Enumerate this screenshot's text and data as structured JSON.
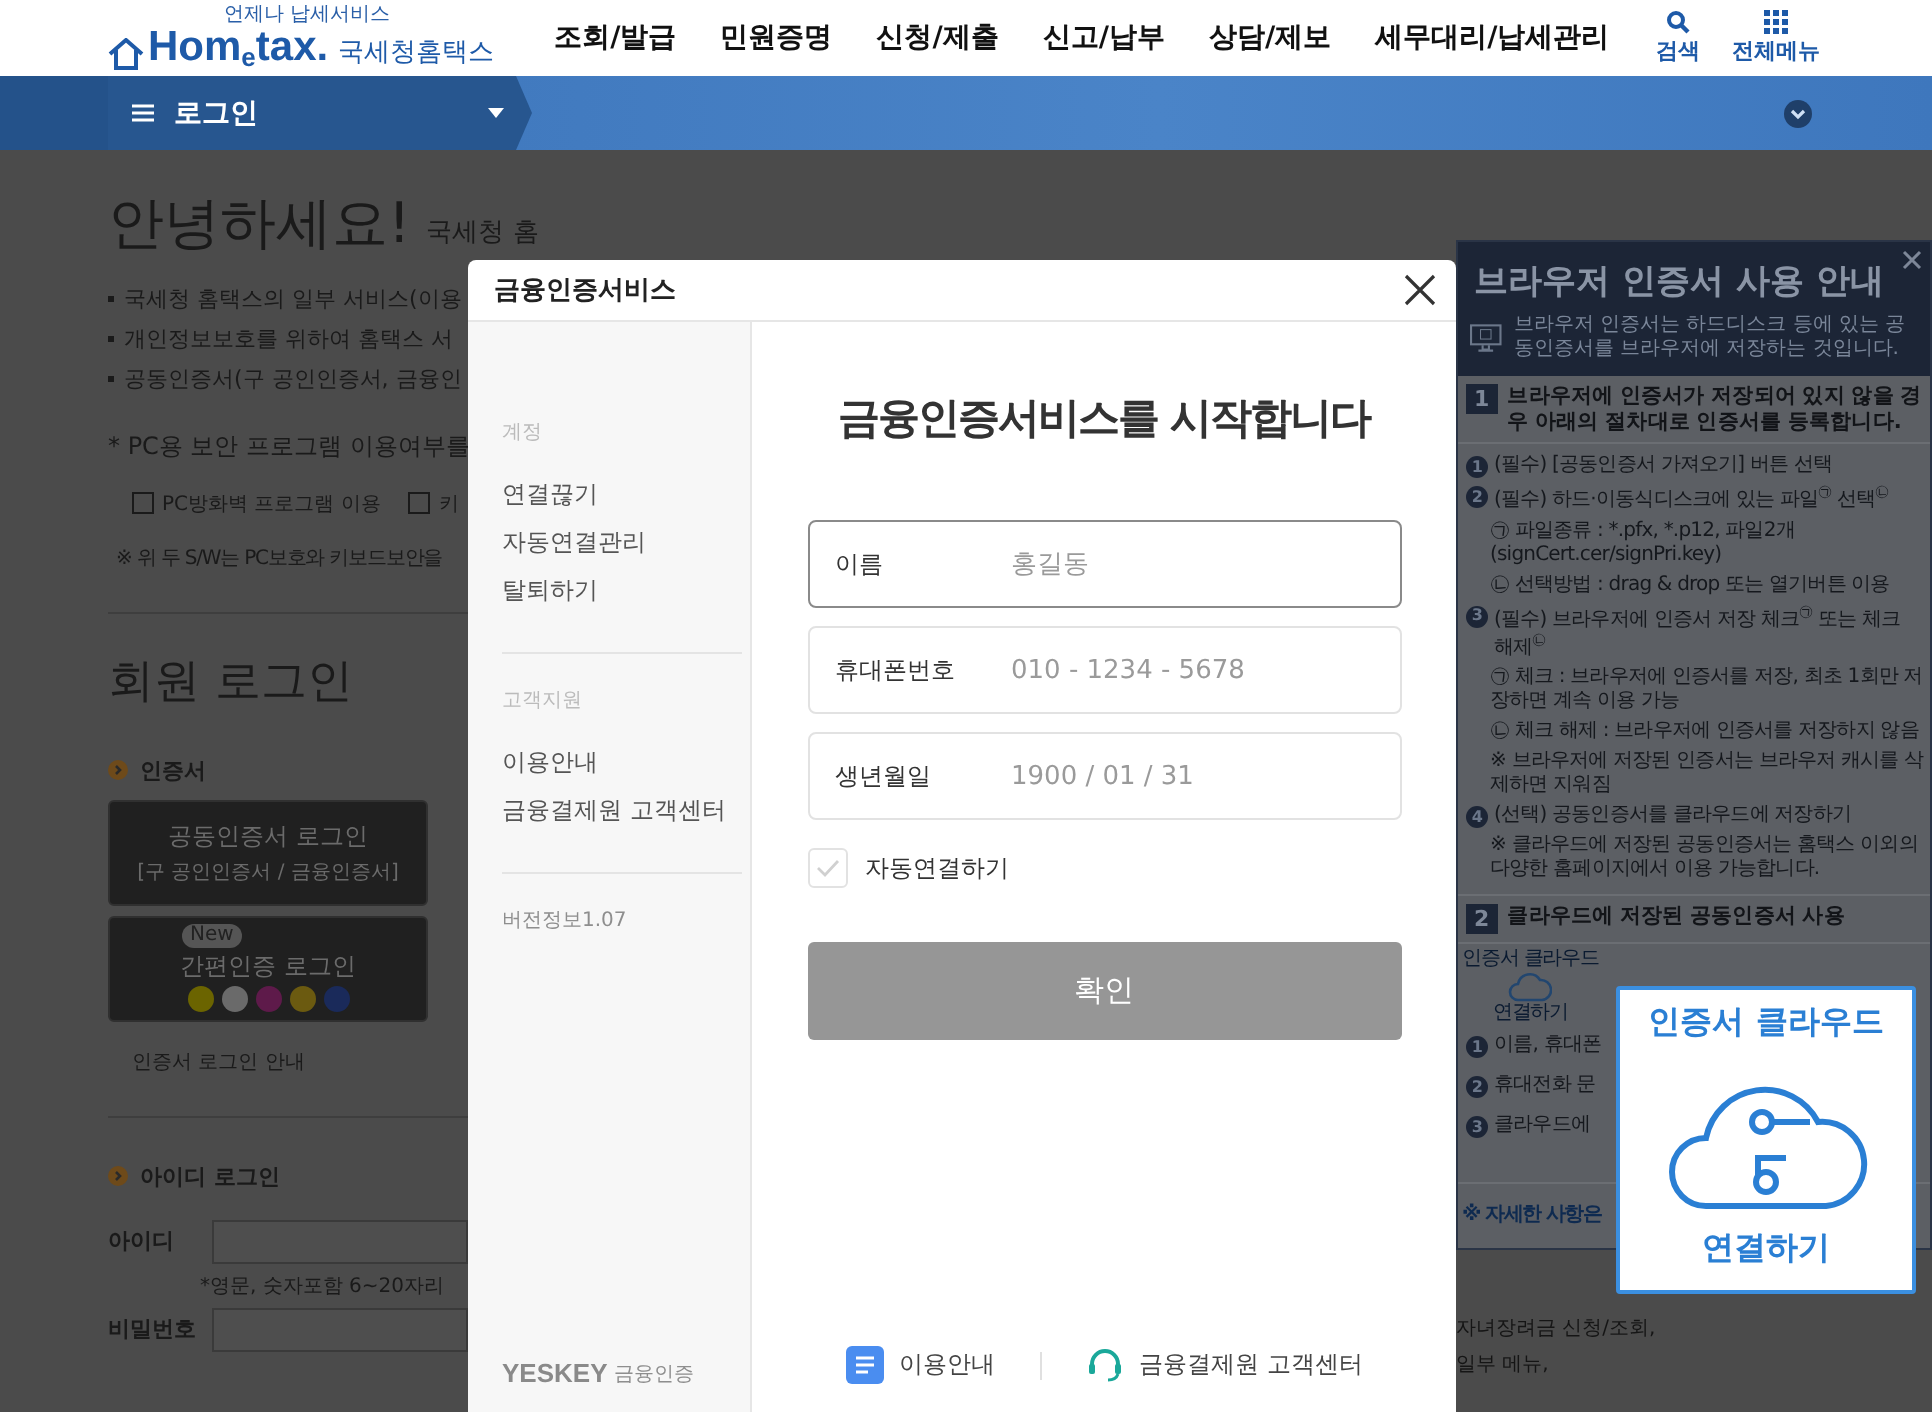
{
  "header": {
    "logo_tagline": "언제나 납세서비스",
    "logo_text": "Hom$_{e}$tax.",
    "logo_name": "국세청홈택스",
    "menu": [
      "조회/발급",
      "민원증명",
      "신청/제출",
      "신고/납부",
      "상담/제보",
      "세무대리/납세관리"
    ],
    "tools": [
      {
        "kind": "search",
        "label": "검색"
      },
      {
        "kind": "menu",
        "label": "전체메뉴"
      }
    ]
  },
  "nav": {
    "title": "로그인"
  },
  "page": {
    "greeting": "안녕하세요!",
    "greeting_sub": "국세청 홈",
    "notices": [
      "국세청 홈택스의 일부 서비스(이용",
      "개인정보보호를 위하여 홈택스 서",
      "공동인증서(구 공인인증서, 금융인"
    ],
    "security_title": "* PC용 보안 프로그램 이용여부를",
    "security_options": [
      {
        "label": "PC방화벽 프로그램 이용",
        "checked": false
      },
      {
        "label": "키",
        "checked": false
      }
    ],
    "security_note": "※ 위 두 S/W는 PC보호와 키보드보안을",
    "member_login_title": "회원 로그인",
    "cert_section": {
      "title": "인증서",
      "buttons": [
        {
          "kind": "cert",
          "title": "공동인증서 로그인",
          "subtitle": "[구 공인인증서 / 금융인증서]"
        },
        {
          "kind": "simple",
          "badge": "New",
          "title": "간편인증 로그인"
        }
      ],
      "guide_link": "인증서 로그인 안내"
    },
    "id_section": {
      "title": "아이디 로그인",
      "fields": [
        {
          "label": "아이디",
          "hint": "*영문, 숫자포함 6~20자리"
        },
        {
          "label": "비밀번호"
        }
      ]
    }
  },
  "modal": {
    "title": "금융인증서비스",
    "sidebar": {
      "sections": [
        {
          "heading": "계정",
          "items": [
            "연결끊기",
            "자동연결관리",
            "탈퇴하기"
          ]
        },
        {
          "heading": "고객지원",
          "items": [
            "이용안내",
            "금융결제원 고객센터"
          ]
        }
      ],
      "version": "버전정보1.07",
      "brand": "YESKEY",
      "brand_caption": "금융인증"
    },
    "heading": "금융인증서비스를 시작합니다",
    "fields": [
      {
        "label": "이름",
        "placeholder": "홍길동",
        "focused": true
      },
      {
        "label": "휴대폰번호",
        "placeholder": "010 - 1234 - 5678",
        "focused": false
      },
      {
        "label": "생년월일",
        "placeholder": "1900 / 01 / 31",
        "focused": false
      }
    ],
    "auto_connect": {
      "label": "자동연결하기",
      "checked": false
    },
    "confirm_button": {
      "label": "확인",
      "disabled": true
    },
    "footer_links": [
      {
        "kind": "guide",
        "label": "이용안내"
      },
      {
        "kind": "support",
        "label": "금융결제원 고객센터"
      }
    ]
  },
  "guide": {
    "title": "브라우저 인증서 사용 안내",
    "intro": "브라우저 인증서는 하드디스크 등에 있는 공동인증서를 브라우저에 저장하는 것입니다.",
    "steps": [
      {
        "number": "1",
        "title": "브라우저에 인증서가 저장되어 있지 않을 경우 아래의 절차대로 인증서를 등록합니다.",
        "lines": [
          {
            "kind": "item",
            "num": "1",
            "text": "(필수) [공동인증서 가져오기] 버튼 선택"
          },
          {
            "kind": "item",
            "num": "2",
            "text": "(필수) 하드·이동식디스크에 있는 파일$^{㉠}$ 선택$^{㉡}$"
          },
          {
            "kind": "sub",
            "text": "㉠ 파일종류 : *.pfx, *.p12, 파일2개 (signCert.cer/signPri.key)"
          },
          {
            "kind": "sub",
            "text": "㉡ 선택방법 : drag & drop 또는 열기버튼 이용"
          },
          {
            "kind": "item",
            "num": "3",
            "text": "(필수) 브라우저에 인증서 저장 체크$^{㉠}$ 또는 체크 해제$^{㉡}$"
          },
          {
            "kind": "sub",
            "text": "㉠ 체크 : 브라우저에 인증서를 저장, 최초 1회만 저장하면 계속 이용 가능"
          },
          {
            "kind": "sub",
            "text": "㉡ 체크 해제 : 브라우저에 인증서를 저장하지 않음"
          },
          {
            "kind": "sub",
            "text": "※ 브라우저에 저장된 인증서는 브라우저 캐시를 삭제하면 지워짐"
          },
          {
            "kind": "item",
            "num": "4",
            "text": "(선택) 공동인증서를 클라우드에 저장하기"
          },
          {
            "kind": "sub",
            "text": "※ 클라우드에 저장된 공동인증서는 홈택스 이외의 다양한 홈페이지에서 이용 가능합니다."
          }
        ]
      },
      {
        "number": "2",
        "title": "클라우드에 저장된 공동인증서 사용",
        "badge_top": "인증서 클라우드",
        "badge_bottom": "연결하기",
        "lines": [
          {
            "kind": "item",
            "num": "1",
            "text": "이름, 휴대폰"
          },
          {
            "kind": "item",
            "num": "2",
            "text": "휴대전화 문"
          },
          {
            "kind": "item",
            "num": "3",
            "text": "클라우드에"
          }
        ]
      }
    ],
    "footnote": "※ 자세한 사항은"
  },
  "page_right_text": [
    "자녀장려금 신청/조회,",
    "일부 메뉴,"
  ],
  "cloud_popup": {
    "title": "인증서 클라우드",
    "action": "연결하기"
  }
}
